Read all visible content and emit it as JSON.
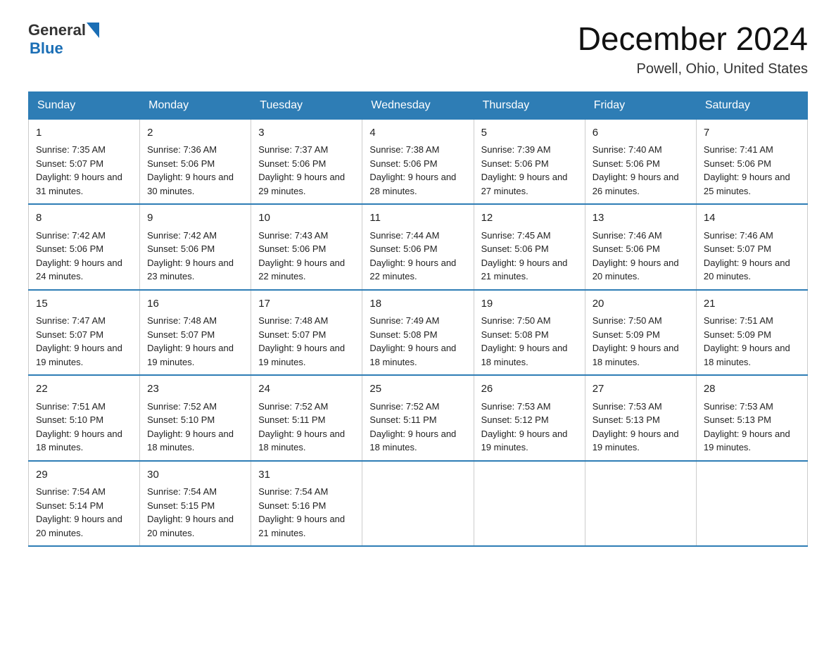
{
  "header": {
    "logo_general": "General",
    "logo_blue": "Blue",
    "month": "December 2024",
    "location": "Powell, Ohio, United States"
  },
  "days_of_week": [
    "Sunday",
    "Monday",
    "Tuesday",
    "Wednesday",
    "Thursday",
    "Friday",
    "Saturday"
  ],
  "weeks": [
    [
      {
        "day": "1",
        "sunrise": "7:35 AM",
        "sunset": "5:07 PM",
        "daylight": "9 hours and 31 minutes."
      },
      {
        "day": "2",
        "sunrise": "7:36 AM",
        "sunset": "5:06 PM",
        "daylight": "9 hours and 30 minutes."
      },
      {
        "day": "3",
        "sunrise": "7:37 AM",
        "sunset": "5:06 PM",
        "daylight": "9 hours and 29 minutes."
      },
      {
        "day": "4",
        "sunrise": "7:38 AM",
        "sunset": "5:06 PM",
        "daylight": "9 hours and 28 minutes."
      },
      {
        "day": "5",
        "sunrise": "7:39 AM",
        "sunset": "5:06 PM",
        "daylight": "9 hours and 27 minutes."
      },
      {
        "day": "6",
        "sunrise": "7:40 AM",
        "sunset": "5:06 PM",
        "daylight": "9 hours and 26 minutes."
      },
      {
        "day": "7",
        "sunrise": "7:41 AM",
        "sunset": "5:06 PM",
        "daylight": "9 hours and 25 minutes."
      }
    ],
    [
      {
        "day": "8",
        "sunrise": "7:42 AM",
        "sunset": "5:06 PM",
        "daylight": "9 hours and 24 minutes."
      },
      {
        "day": "9",
        "sunrise": "7:42 AM",
        "sunset": "5:06 PM",
        "daylight": "9 hours and 23 minutes."
      },
      {
        "day": "10",
        "sunrise": "7:43 AM",
        "sunset": "5:06 PM",
        "daylight": "9 hours and 22 minutes."
      },
      {
        "day": "11",
        "sunrise": "7:44 AM",
        "sunset": "5:06 PM",
        "daylight": "9 hours and 22 minutes."
      },
      {
        "day": "12",
        "sunrise": "7:45 AM",
        "sunset": "5:06 PM",
        "daylight": "9 hours and 21 minutes."
      },
      {
        "day": "13",
        "sunrise": "7:46 AM",
        "sunset": "5:06 PM",
        "daylight": "9 hours and 20 minutes."
      },
      {
        "day": "14",
        "sunrise": "7:46 AM",
        "sunset": "5:07 PM",
        "daylight": "9 hours and 20 minutes."
      }
    ],
    [
      {
        "day": "15",
        "sunrise": "7:47 AM",
        "sunset": "5:07 PM",
        "daylight": "9 hours and 19 minutes."
      },
      {
        "day": "16",
        "sunrise": "7:48 AM",
        "sunset": "5:07 PM",
        "daylight": "9 hours and 19 minutes."
      },
      {
        "day": "17",
        "sunrise": "7:48 AM",
        "sunset": "5:07 PM",
        "daylight": "9 hours and 19 minutes."
      },
      {
        "day": "18",
        "sunrise": "7:49 AM",
        "sunset": "5:08 PM",
        "daylight": "9 hours and 18 minutes."
      },
      {
        "day": "19",
        "sunrise": "7:50 AM",
        "sunset": "5:08 PM",
        "daylight": "9 hours and 18 minutes."
      },
      {
        "day": "20",
        "sunrise": "7:50 AM",
        "sunset": "5:09 PM",
        "daylight": "9 hours and 18 minutes."
      },
      {
        "day": "21",
        "sunrise": "7:51 AM",
        "sunset": "5:09 PM",
        "daylight": "9 hours and 18 minutes."
      }
    ],
    [
      {
        "day": "22",
        "sunrise": "7:51 AM",
        "sunset": "5:10 PM",
        "daylight": "9 hours and 18 minutes."
      },
      {
        "day": "23",
        "sunrise": "7:52 AM",
        "sunset": "5:10 PM",
        "daylight": "9 hours and 18 minutes."
      },
      {
        "day": "24",
        "sunrise": "7:52 AM",
        "sunset": "5:11 PM",
        "daylight": "9 hours and 18 minutes."
      },
      {
        "day": "25",
        "sunrise": "7:52 AM",
        "sunset": "5:11 PM",
        "daylight": "9 hours and 18 minutes."
      },
      {
        "day": "26",
        "sunrise": "7:53 AM",
        "sunset": "5:12 PM",
        "daylight": "9 hours and 19 minutes."
      },
      {
        "day": "27",
        "sunrise": "7:53 AM",
        "sunset": "5:13 PM",
        "daylight": "9 hours and 19 minutes."
      },
      {
        "day": "28",
        "sunrise": "7:53 AM",
        "sunset": "5:13 PM",
        "daylight": "9 hours and 19 minutes."
      }
    ],
    [
      {
        "day": "29",
        "sunrise": "7:54 AM",
        "sunset": "5:14 PM",
        "daylight": "9 hours and 20 minutes."
      },
      {
        "day": "30",
        "sunrise": "7:54 AM",
        "sunset": "5:15 PM",
        "daylight": "9 hours and 20 minutes."
      },
      {
        "day": "31",
        "sunrise": "7:54 AM",
        "sunset": "5:16 PM",
        "daylight": "9 hours and 21 minutes."
      },
      {
        "day": "",
        "sunrise": "",
        "sunset": "",
        "daylight": ""
      },
      {
        "day": "",
        "sunrise": "",
        "sunset": "",
        "daylight": ""
      },
      {
        "day": "",
        "sunrise": "",
        "sunset": "",
        "daylight": ""
      },
      {
        "day": "",
        "sunrise": "",
        "sunset": "",
        "daylight": ""
      }
    ]
  ],
  "labels": {
    "sunrise_prefix": "Sunrise: ",
    "sunset_prefix": "Sunset: ",
    "daylight_prefix": "Daylight: "
  }
}
